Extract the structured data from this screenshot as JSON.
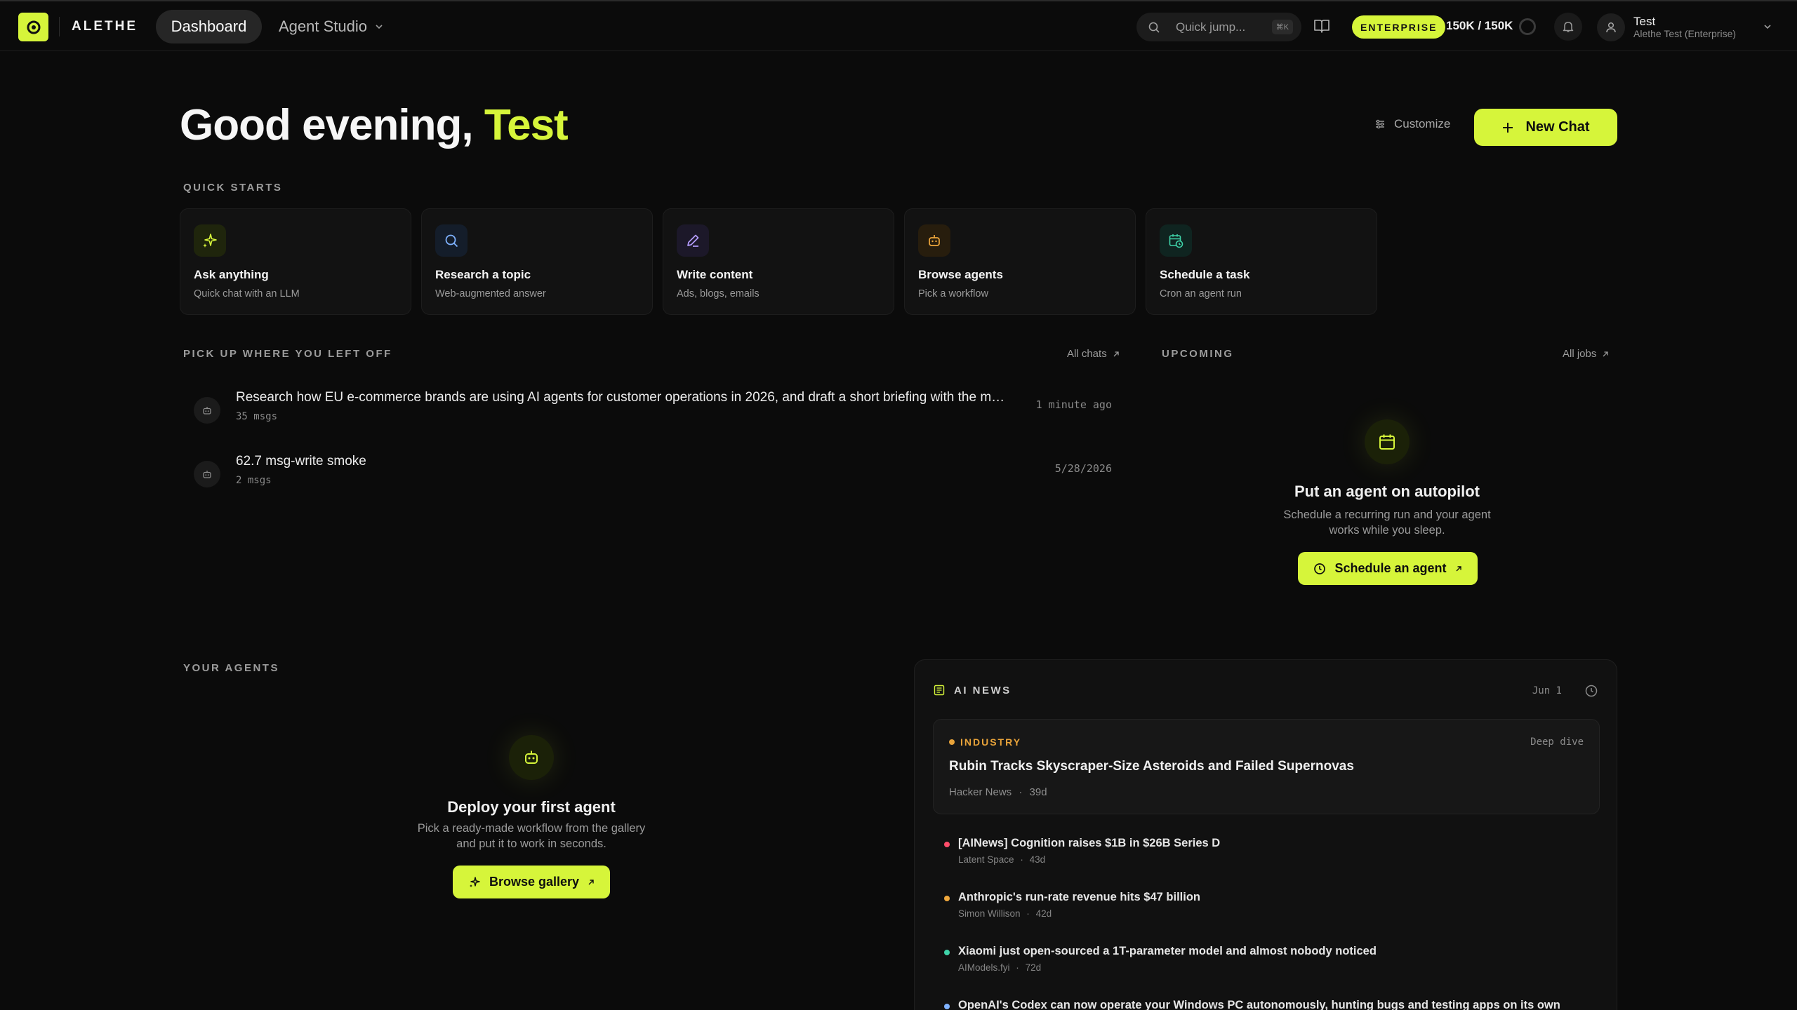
{
  "header": {
    "brand": "ALETHE",
    "nav": {
      "dashboard": "Dashboard",
      "agent_studio": "Agent Studio"
    },
    "search": {
      "label": "Quick jump...",
      "shortcut": "⌘K"
    },
    "plan_badge": "ENTERPRISE",
    "credits": "150K / 150K",
    "user": {
      "name": "Test",
      "org": "Alethe Test (Enterprise)"
    }
  },
  "greeting": {
    "prefix": "Good evening,",
    "name": "Test"
  },
  "actions": {
    "customize": "Customize",
    "new_chat": "New Chat"
  },
  "quick_starts": {
    "label": "QUICK STARTS",
    "items": [
      {
        "title": "Ask anything",
        "subtitle": "Quick chat with an LLM",
        "icon": "sparkles-icon",
        "color": "#d6f53a"
      },
      {
        "title": "Research a topic",
        "subtitle": "Web-augmented answer",
        "icon": "search-icon",
        "color": "#7fb2ff"
      },
      {
        "title": "Write content",
        "subtitle": "Ads, blogs, emails",
        "icon": "pen-icon",
        "color": "#b49cff"
      },
      {
        "title": "Browse agents",
        "subtitle": "Pick a workflow",
        "icon": "robot-icon",
        "color": "#f0a83c"
      },
      {
        "title": "Schedule a task",
        "subtitle": "Cron an agent run",
        "icon": "calendar-clock-icon",
        "color": "#3fd3a9"
      }
    ]
  },
  "recent": {
    "label": "PICK UP WHERE YOU LEFT OFF",
    "all_link": "All chats",
    "chats": [
      {
        "title": "Research how EU e-commerce brands are using AI agents for customer operations in 2026, and draft a short briefing with the most notable examples",
        "meta": "35 msgs",
        "time": "1 minute ago"
      },
      {
        "title": "62.7 msg-write smoke",
        "meta": "2 msgs",
        "time": "5/28/2026"
      }
    ]
  },
  "upcoming": {
    "label": "UPCOMING",
    "all_link": "All jobs",
    "empty_title": "Put an agent on autopilot",
    "empty_desc_1": "Schedule a recurring run and your agent",
    "empty_desc_2": "works while you sleep.",
    "cta": "Schedule an agent"
  },
  "agents": {
    "label": "YOUR AGENTS",
    "empty_title": "Deploy your first agent",
    "empty_desc_1": "Pick a ready-made workflow from the gallery",
    "empty_desc_2": "and put it to work in seconds.",
    "cta": "Browse gallery"
  },
  "news": {
    "label": "AI NEWS",
    "date": "Jun 1",
    "featured": {
      "category": "INDUSTRY",
      "tag": "Deep dive",
      "title": "Rubin Tracks Skyscraper-Size Asteroids and Failed Supernovas",
      "source": "Hacker News",
      "age": "39d"
    },
    "items": [
      {
        "title": "[AINews] Cognition raises $1B in $26B Series D",
        "source": "Latent Space",
        "age": "43d",
        "color": "#ff4d6a"
      },
      {
        "title": "Anthropic's run-rate revenue hits $47 billion",
        "source": "Simon Willison",
        "age": "42d",
        "color": "#f0a83c"
      },
      {
        "title": "Xiaomi just open-sourced a 1T-parameter model and almost nobody noticed",
        "source": "AIModels.fyi",
        "age": "72d",
        "color": "#3fd3a9"
      },
      {
        "title": "OpenAI's Codex can now operate your Windows PC autonomously, hunting bugs and testing apps on its own",
        "source": "",
        "age": "",
        "color": "#7fb2ff"
      }
    ],
    "separator": "·"
  },
  "colors": {
    "accent": "#d6f53a",
    "background": "#0b0b0b",
    "industry": "#e8a33a"
  }
}
